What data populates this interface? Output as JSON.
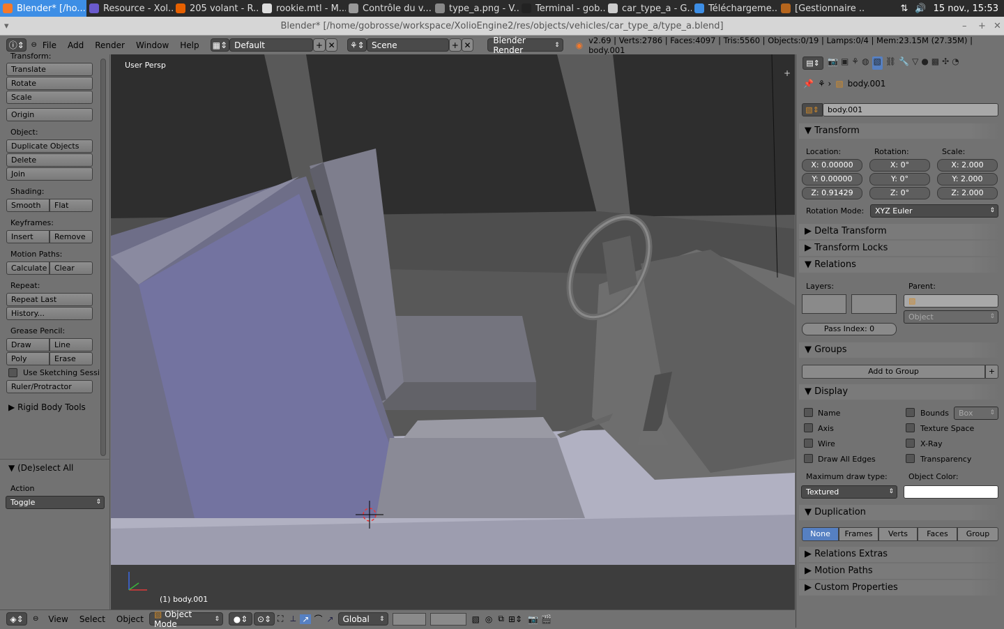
{
  "taskbar": {
    "tasks": [
      {
        "label": "Blender* [/ho...",
        "icon": "blender-icon",
        "color": "#f5792a"
      },
      {
        "label": "Resource - Xol...",
        "icon": "eclipse-icon",
        "color": "#6a5acd"
      },
      {
        "label": "205 volant - R...",
        "icon": "firefox-icon",
        "color": "#e66000"
      },
      {
        "label": "rookie.mtl - M...",
        "icon": "editor-icon",
        "color": "#dddddd"
      },
      {
        "label": "Contrôle du v...",
        "icon": "speaker-icon",
        "color": "#999999"
      },
      {
        "label": "type_a.png - V...",
        "icon": "image-icon",
        "color": "#888888"
      },
      {
        "label": "Terminal - gob...",
        "icon": "terminal-icon",
        "color": "#222222"
      },
      {
        "label": "car_type_a - G...",
        "icon": "folder-icon",
        "color": "#cccccc"
      },
      {
        "label": "Téléchargeme...",
        "icon": "download-icon",
        "color": "#3d8ee5"
      },
      {
        "label": "[Gestionnaire ...",
        "icon": "archive-icon",
        "color": "#b5651d"
      }
    ],
    "clock": "15 nov., 15:53"
  },
  "window": {
    "title": "Blender* [/home/gobrosse/workspace/XolioEngine2/res/objects/vehicles/car_type_a/type_a.blend]"
  },
  "info_header": {
    "menus": [
      "File",
      "Add",
      "Render",
      "Window",
      "Help"
    ],
    "layout": "Default",
    "scene": "Scene",
    "engine": "Blender Render",
    "stats": "v2.69 | Verts:2786 | Faces:4097 | Tris:5560 | Objects:0/19 | Lamps:0/4 | Mem:23.15M (27.35M) | body.001"
  },
  "toolshelf": {
    "transform_label": "Transform:",
    "translate": "Translate",
    "rotate": "Rotate",
    "scale": "Scale",
    "origin": "Origin",
    "object_label": "Object:",
    "duplicate": "Duplicate Objects",
    "delete": "Delete",
    "join": "Join",
    "shading_label": "Shading:",
    "smooth": "Smooth",
    "flat": "Flat",
    "keyframes_label": "Keyframes:",
    "insert": "Insert",
    "remove": "Remove",
    "motion_label": "Motion Paths:",
    "calculate": "Calculate",
    "clear": "Clear",
    "repeat_label": "Repeat:",
    "repeat_last": "Repeat Last",
    "history": "History...",
    "grease_label": "Grease Pencil:",
    "draw": "Draw",
    "line": "Line",
    "poly": "Poly",
    "erase": "Erase",
    "use_sketching": "Use Sketching Sessi",
    "ruler": "Ruler/Protractor",
    "rigid_body": "Rigid Body Tools",
    "operator_title": "(De)select All",
    "action_label": "Action",
    "action_value": "Toggle"
  },
  "viewport": {
    "view_name": "User Persp",
    "object_info": "(1) body.001"
  },
  "properties": {
    "breadcrumb": "body.001",
    "object_name": "body.001",
    "transform": {
      "title": "Transform",
      "location_label": "Location:",
      "rotation_label": "Rotation:",
      "scale_label": "Scale:",
      "loc": [
        "X: 0.00000",
        "Y: 0.00000",
        "Z: 0.91429"
      ],
      "rot": [
        "X: 0°",
        "Y: 0°",
        "Z: 0°"
      ],
      "scl": [
        "X: 2.000",
        "Y: 2.000",
        "Z: 2.000"
      ],
      "rotation_mode_label": "Rotation Mode:",
      "rotation_mode": "XYZ Euler"
    },
    "delta_transform": "Delta Transform",
    "transform_locks": "Transform Locks",
    "relations": {
      "title": "Relations",
      "layers_label": "Layers:",
      "parent_label": "Parent:",
      "parent_type": "Object",
      "pass_index": "Pass Index: 0"
    },
    "groups": {
      "title": "Groups",
      "add": "Add to Group"
    },
    "display": {
      "title": "Display",
      "name": "Name",
      "bounds": "Bounds",
      "bounds_type": "Box",
      "axis": "Axis",
      "texture_space": "Texture Space",
      "wire": "Wire",
      "xray": "X-Ray",
      "draw_all_edges": "Draw All Edges",
      "transparency": "Transparency",
      "max_draw_label": "Maximum draw type:",
      "max_draw_value": "Textured",
      "object_color_label": "Object Color:",
      "object_color": "#ffffff"
    },
    "duplication": {
      "title": "Duplication",
      "options": [
        "None",
        "Frames",
        "Verts",
        "Faces",
        "Group"
      ],
      "selected": "None"
    },
    "relations_extras": "Relations Extras",
    "motion_paths": "Motion Paths",
    "custom_properties": "Custom Properties"
  },
  "bottom_header": {
    "menus": [
      "View",
      "Select",
      "Object"
    ],
    "mode": "Object Mode",
    "orientation": "Global"
  }
}
